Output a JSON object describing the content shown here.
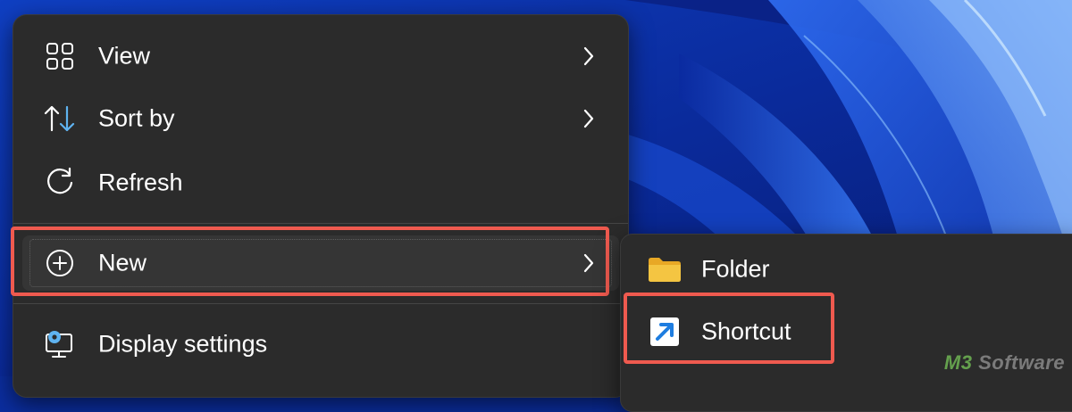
{
  "menu": {
    "items": [
      {
        "label": "View",
        "icon": "grid-icon",
        "has_submenu": true
      },
      {
        "label": "Sort by",
        "icon": "sort-arrows-icon",
        "has_submenu": true
      },
      {
        "label": "Refresh",
        "icon": "refresh-icon",
        "has_submenu": false
      },
      {
        "label": "New",
        "icon": "plus-circle-icon",
        "has_submenu": true,
        "highlighted": true
      },
      {
        "label": "Display settings",
        "icon": "display-settings-icon",
        "has_submenu": false
      }
    ]
  },
  "submenu": {
    "items": [
      {
        "label": "Folder",
        "icon": "folder-icon"
      },
      {
        "label": "Shortcut",
        "icon": "shortcut-icon",
        "highlighted": true
      }
    ]
  },
  "watermark": {
    "prefix": "M3",
    "suffix": " Software"
  },
  "colors": {
    "menu_bg": "#2b2b2b",
    "highlight_border": "#ef5a4f",
    "folder_yellow": "#f4c542",
    "shortcut_blue": "#1e7de0",
    "sort_accent": "#5fb3f0",
    "desktop_blue": "#0b2d9e"
  }
}
